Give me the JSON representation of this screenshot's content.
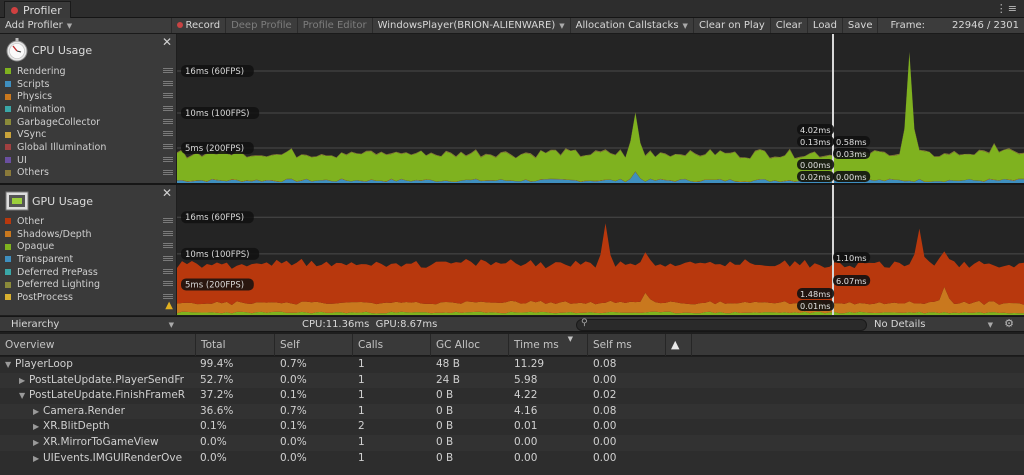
{
  "window": {
    "title": "Profiler",
    "menu_glyph": "⋮≡"
  },
  "toolbar": {
    "add_profiler": "Add Profiler",
    "record": "Record",
    "deep_profile": "Deep Profile",
    "profile_editor": "Profile Editor",
    "target": "WindowsPlayer(BRION-ALIENWARE)",
    "allocation_callstacks": "Allocation Callstacks",
    "clear_on_play": "Clear on Play",
    "clear": "Clear",
    "load": "Load",
    "save": "Save",
    "frame_label": "Frame:",
    "frame_value": "22946 / 2301"
  },
  "cpu_module": {
    "title": "CPU Usage",
    "icon": "stopwatch-icon",
    "legend": [
      {
        "label": "Rendering",
        "color": "#7fb21f"
      },
      {
        "label": "Scripts",
        "color": "#3f8fbf"
      },
      {
        "label": "Physics",
        "color": "#c9781e"
      },
      {
        "label": "Animation",
        "color": "#3aa7a7"
      },
      {
        "label": "GarbageCollector",
        "color": "#8a8a3a"
      },
      {
        "label": "VSync",
        "color": "#c8a23a"
      },
      {
        "label": "Global Illumination",
        "color": "#a04040"
      },
      {
        "label": "UI",
        "color": "#6a4fa0"
      },
      {
        "label": "Others",
        "color": "#8a7a3a"
      }
    ],
    "chart": {
      "type": "area",
      "ylim_ms": [
        0,
        20
      ],
      "guides": [
        {
          "label": "16ms (60FPS)",
          "ms": 16
        },
        {
          "label": "10ms (100FPS)",
          "ms": 10
        },
        {
          "label": "5ms (200FPS)",
          "ms": 5
        }
      ],
      "selection_labels": [
        "4.02ms",
        "0.13ms",
        "0.58ms",
        "0.03ms",
        "0.00ms",
        "0.02ms",
        "0.00ms"
      ]
    }
  },
  "gpu_module": {
    "title": "GPU Usage",
    "icon": "gpu-icon",
    "warning_icon": "warning-icon",
    "legend": [
      {
        "label": "Other",
        "color": "#b8380d"
      },
      {
        "label": "Shadows/Depth",
        "color": "#c9781e"
      },
      {
        "label": "Opaque",
        "color": "#7fb21f"
      },
      {
        "label": "Transparent",
        "color": "#3f8fbf"
      },
      {
        "label": "Deferred PrePass",
        "color": "#3aa7a7"
      },
      {
        "label": "Deferred Lighting",
        "color": "#8a8a3a"
      },
      {
        "label": "PostProcess",
        "color": "#d8b030"
      }
    ],
    "chart": {
      "type": "area",
      "ylim_ms": [
        0,
        20
      ],
      "guides": [
        {
          "label": "16ms (60FPS)",
          "ms": 16
        },
        {
          "label": "10ms (100FPS)",
          "ms": 10
        },
        {
          "label": "5ms (200FPS)",
          "ms": 5
        }
      ],
      "selection_labels": [
        "1.10ms",
        "6.07ms",
        "1.48ms",
        "0.01ms"
      ]
    }
  },
  "details_bar": {
    "view": "Hierarchy",
    "cpu": "CPU:11.36ms",
    "gpu": "GPU:8.67ms",
    "search_placeholder": "",
    "details": "No Details"
  },
  "table": {
    "columns": [
      "Overview",
      "Total",
      "Self",
      "Calls",
      "GC Alloc",
      "Time ms",
      "Self ms",
      "▲"
    ],
    "rows": [
      {
        "name": "PlayerLoop",
        "indent": 0,
        "expander": "▼",
        "total": "99.4%",
        "self": "0.7%",
        "calls": "1",
        "gc": "48 B",
        "time": "11.29",
        "selfms": "0.08"
      },
      {
        "name": "PostLateUpdate.PlayerSendFr",
        "indent": 1,
        "expander": "▶",
        "total": "52.7%",
        "self": "0.0%",
        "calls": "1",
        "gc": "24 B",
        "time": "5.98",
        "selfms": "0.00"
      },
      {
        "name": "PostLateUpdate.FinishFrameR",
        "indent": 1,
        "expander": "▼",
        "total": "37.2%",
        "self": "0.1%",
        "calls": "1",
        "gc": "0 B",
        "time": "4.22",
        "selfms": "0.02"
      },
      {
        "name": "Camera.Render",
        "indent": 2,
        "expander": "▶",
        "total": "36.6%",
        "self": "0.7%",
        "calls": "1",
        "gc": "0 B",
        "time": "4.16",
        "selfms": "0.08"
      },
      {
        "name": "XR.BlitDepth",
        "indent": 2,
        "expander": "▶",
        "total": "0.1%",
        "self": "0.1%",
        "calls": "2",
        "gc": "0 B",
        "time": "0.01",
        "selfms": "0.00"
      },
      {
        "name": "XR.MirrorToGameView",
        "indent": 2,
        "expander": "▶",
        "total": "0.0%",
        "self": "0.0%",
        "calls": "1",
        "gc": "0 B",
        "time": "0.00",
        "selfms": "0.00"
      },
      {
        "name": "UIEvents.IMGUIRenderOve",
        "indent": 2,
        "expander": "▶",
        "total": "0.0%",
        "self": "0.0%",
        "calls": "1",
        "gc": "0 B",
        "time": "0.00",
        "selfms": "0.00"
      }
    ]
  }
}
